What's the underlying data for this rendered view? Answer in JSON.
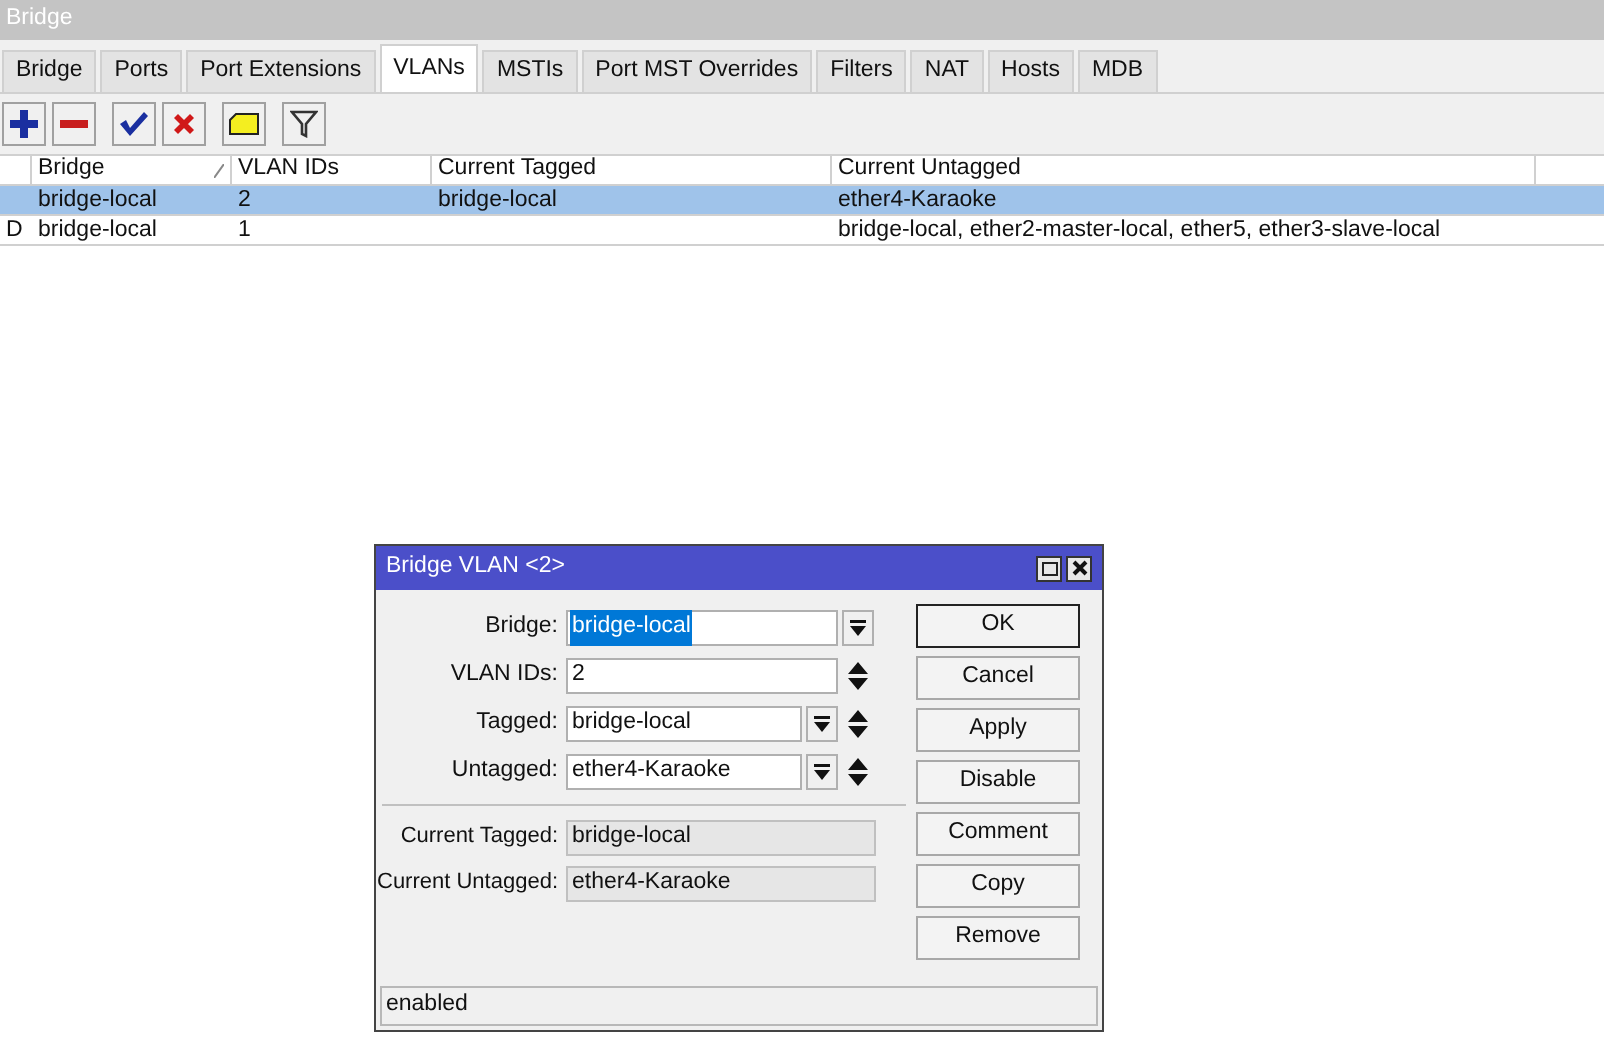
{
  "window": {
    "title": "Bridge"
  },
  "tabs": [
    {
      "label": "Bridge",
      "selected": false
    },
    {
      "label": "Ports",
      "selected": false
    },
    {
      "label": "Port Extensions",
      "selected": false
    },
    {
      "label": "VLANs",
      "selected": true
    },
    {
      "label": "MSTIs",
      "selected": false
    },
    {
      "label": "Port MST Overrides",
      "selected": false
    },
    {
      "label": "Filters",
      "selected": false
    },
    {
      "label": "NAT",
      "selected": false
    },
    {
      "label": "Hosts",
      "selected": false
    },
    {
      "label": "MDB",
      "selected": false
    }
  ],
  "table": {
    "columns": [
      {
        "label": "Bridge",
        "sorted": true
      },
      {
        "label": "VLAN IDs",
        "sorted": false
      },
      {
        "label": "Current Tagged",
        "sorted": false
      },
      {
        "label": "Current Untagged",
        "sorted": false
      }
    ],
    "rows": [
      {
        "flag": "",
        "selected": true,
        "cells": [
          "bridge-local",
          "2",
          "bridge-local",
          "ether4-Karaoke"
        ]
      },
      {
        "flag": "D",
        "selected": false,
        "cells": [
          "bridge-local",
          "1",
          "",
          "bridge-local, ether2-master-local, ether5, ether3-slave-local"
        ]
      }
    ]
  },
  "dialog": {
    "title": "Bridge VLAN <2>",
    "fields": [
      {
        "label": "Bridge:",
        "value": "bridge-local",
        "kind": "select",
        "highlighted": true
      },
      {
        "label": "VLAN IDs:",
        "value": "2",
        "kind": "number",
        "highlighted": false
      },
      {
        "label": "Tagged:",
        "value": "bridge-local",
        "kind": "list",
        "highlighted": false
      },
      {
        "label": "Untagged:",
        "value": "ether4-Karaoke",
        "kind": "list",
        "highlighted": false
      }
    ],
    "readonly_fields": [
      {
        "label": "Current Tagged:",
        "value": "bridge-local"
      },
      {
        "label": "Current Untagged:",
        "value": "ether4-Karaoke"
      }
    ],
    "buttons": [
      {
        "label": "OK",
        "default": true
      },
      {
        "label": "Cancel",
        "default": false
      },
      {
        "label": "Apply",
        "default": false
      },
      {
        "label": "Disable",
        "default": false
      },
      {
        "label": "Comment",
        "default": false
      },
      {
        "label": "Copy",
        "default": false
      },
      {
        "label": "Remove",
        "default": false
      }
    ],
    "status": "enabled"
  }
}
